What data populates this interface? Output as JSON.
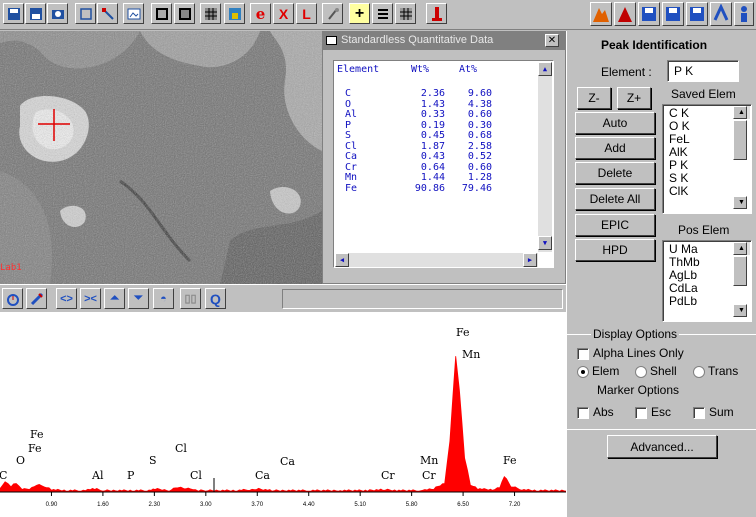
{
  "toolbar": {
    "icons": [
      "save-icon",
      "open-icon",
      "camera-icon",
      "zoom-icon",
      "pointer-icon",
      "image-icon",
      "film-icon",
      "frame-icon",
      "grid-icon",
      "picture-icon",
      "e-marker-icon",
      "close-x-icon",
      "l-marker-icon",
      "tools-icon",
      "crosshair-icon",
      "list-icon",
      "table-icon",
      "tower-icon"
    ],
    "right_icons": [
      "mountain-icon",
      "peak-icon",
      "disk-icon",
      "disk2-icon",
      "disk3-icon",
      "run-icon",
      "person-icon"
    ],
    "e_label": "e",
    "x_label": "X",
    "l_label": "L",
    "plus_label": "+"
  },
  "image_panel": {
    "overlay_text": "Lab1"
  },
  "quant": {
    "title": "Standardless Quantitative Data",
    "headers": [
      "Element",
      "Wt%",
      "At%"
    ],
    "rows": [
      {
        "el": "C",
        "wt": "2.36",
        "at": "9.60"
      },
      {
        "el": "O",
        "wt": "1.43",
        "at": "4.38"
      },
      {
        "el": "Al",
        "wt": "0.33",
        "at": "0.60"
      },
      {
        "el": "P",
        "wt": "0.19",
        "at": "0.30"
      },
      {
        "el": "S",
        "wt": "0.45",
        "at": "0.68"
      },
      {
        "el": "Cl",
        "wt": "1.87",
        "at": "2.58"
      },
      {
        "el": "Ca",
        "wt": "0.43",
        "at": "0.52"
      },
      {
        "el": "Cr",
        "wt": "0.64",
        "at": "0.60"
      },
      {
        "el": "Mn",
        "wt": "1.44",
        "at": "1.28"
      },
      {
        "el": "Fe",
        "wt": "90.86",
        "at": "79.46"
      }
    ]
  },
  "spec_toolbar": {
    "q_label": "Q"
  },
  "peak_id": {
    "title": "Peak Identification",
    "element_label": "Element :",
    "element_value": "P K",
    "zminus": "Z-",
    "zplus": "Z+",
    "saved_title": "Saved Elem",
    "saved": [
      "C K",
      "O K",
      "FeL",
      "AlK",
      "P K",
      "S K",
      "ClK"
    ],
    "auto": "Auto",
    "add": "Add",
    "delete": "Delete",
    "delete_all": "Delete All",
    "epic": "EPIC",
    "hpd": "HPD",
    "pos_title": "Pos Elem",
    "pos": [
      "U Ma",
      "ThMb",
      "AgLb",
      "CdLa",
      "PdLb"
    ],
    "display_title": "Display Options",
    "alpha_only": "Alpha Lines Only",
    "elem": "Elem",
    "shell": "Shell",
    "trans": "Trans",
    "marker_title": "Marker Options",
    "abs": "Abs",
    "esc": "Esc",
    "sum": "Sum",
    "advanced": "Advanced..."
  },
  "chart_data": {
    "type": "line",
    "title": "",
    "xlabel": "",
    "ylabel": "",
    "xlim": [
      0.2,
      7.9
    ],
    "x_ticks": [
      "0.90",
      "1.60",
      "2.30",
      "3.00",
      "3.70",
      "4.40",
      "5.10",
      "5.80",
      "6.50",
      "7.20"
    ],
    "series": [
      {
        "x": [
          0.2,
          0.27,
          0.35,
          0.42,
          0.5,
          0.53,
          0.6,
          0.7,
          0.8,
          0.9,
          1.1,
          1.3,
          1.49,
          1.6,
          1.8,
          2.0,
          2.2,
          2.31,
          2.5,
          2.62,
          2.7,
          2.82,
          2.9,
          3.0,
          3.2,
          3.4,
          3.6,
          3.69,
          3.9,
          4.1,
          4.4,
          4.8,
          5.2,
          5.41,
          5.6,
          5.9,
          5.95,
          6.1,
          6.25,
          6.32,
          6.4,
          6.45,
          6.52,
          6.6,
          6.7,
          6.9,
          7.0,
          7.06,
          7.15,
          7.3,
          7.5,
          7.9
        ],
        "y": [
          4,
          12,
          6,
          10,
          3,
          4,
          3,
          8,
          6,
          2,
          1,
          1,
          3,
          1,
          1,
          1,
          1,
          3,
          1,
          5,
          4,
          3,
          1,
          1,
          1,
          1,
          2,
          3,
          1,
          1,
          1,
          1,
          1,
          2,
          1,
          1,
          2,
          3,
          10,
          60,
          160,
          120,
          40,
          8,
          3,
          2,
          5,
          18,
          6,
          2,
          1,
          1
        ]
      }
    ],
    "peak_labels": [
      {
        "label": "C",
        "x": 0.2
      },
      {
        "label": "O",
        "x": 0.53
      },
      {
        "label": "Fe",
        "x": 0.7
      },
      {
        "label": "Fe",
        "x": 0.7
      },
      {
        "label": "Al",
        "x": 1.49
      },
      {
        "label": "P",
        "x": 2.01
      },
      {
        "label": "S",
        "x": 2.31
      },
      {
        "label": "Cl",
        "x": 2.62
      },
      {
        "label": "Cl",
        "x": 2.82
      },
      {
        "label": "Ca",
        "x": 3.69
      },
      {
        "label": "Ca",
        "x": 4.01
      },
      {
        "label": "Cr",
        "x": 5.41
      },
      {
        "label": "Mn",
        "x": 5.9
      },
      {
        "label": "Cr",
        "x": 5.95
      },
      {
        "label": "Fe",
        "x": 6.4
      },
      {
        "label": "Mn",
        "x": 6.49
      },
      {
        "label": "Fe",
        "x": 7.06
      }
    ],
    "colors": {
      "spectrum": "#ff0000",
      "axis": "#000000"
    }
  }
}
